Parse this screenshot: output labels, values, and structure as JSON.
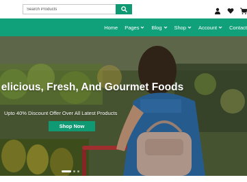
{
  "search": {
    "placeholder": "Search Products",
    "button_icon": "search-icon"
  },
  "top_icons": [
    "user-icon",
    "heart-icon",
    "cart-icon"
  ],
  "nav": {
    "items": [
      {
        "label": "Home",
        "dropdown": false
      },
      {
        "label": "Pages",
        "dropdown": true
      },
      {
        "label": "Blog",
        "dropdown": true
      },
      {
        "label": "Shop",
        "dropdown": true
      },
      {
        "label": "Account",
        "dropdown": true
      },
      {
        "label": "Contact",
        "dropdown": false
      }
    ]
  },
  "hero": {
    "title": "elicious, Fresh, And Gourmet Foods",
    "subtitle": "Upto 40% Discount Offer Over All Latest Products",
    "button_label": "Shop Now",
    "slides_count": 3,
    "active_slide": 1
  },
  "colors": {
    "brand_green": "#10a07a",
    "button_green": "#0f9a73",
    "white": "#ffffff"
  }
}
